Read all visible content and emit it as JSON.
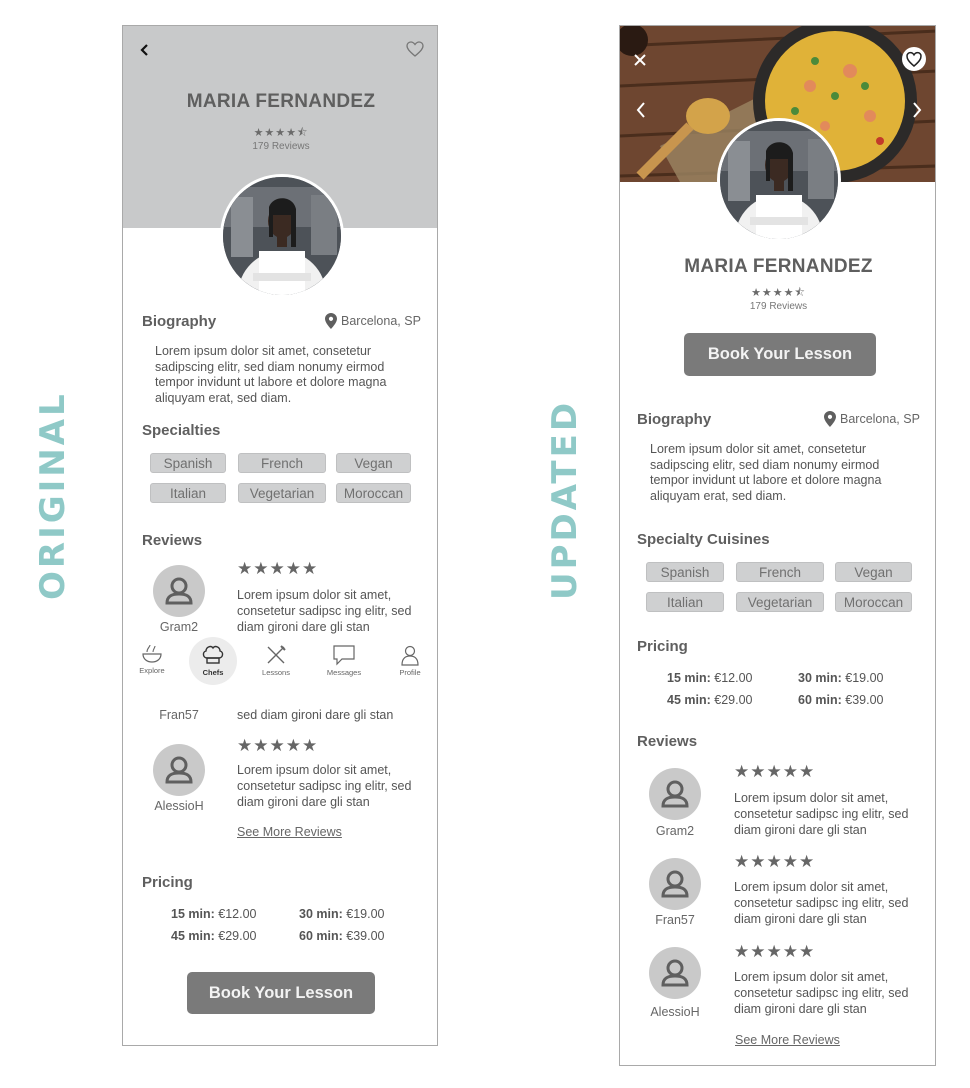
{
  "labels": {
    "original": "ORIGINAL",
    "updated": "UPDATED"
  },
  "chef": {
    "name": "MARIA FERNANDEZ",
    "stars": "★★★★⯪",
    "reviews_count": "179 Reviews",
    "location": "Barcelona, SP"
  },
  "biography": {
    "title": "Biography",
    "text": "Lorem ipsum dolor sit amet, consetetur sadipscing elitr, sed diam nonumy eirmod tempor invidunt ut labore et dolore magna aliquyam erat, sed diam."
  },
  "specialties": {
    "title_original": "Specialties",
    "title_updated": "Specialty Cuisines",
    "items": [
      "Spanish",
      "French",
      "Vegan",
      "Italian",
      "Vegetarian",
      "Moroccan"
    ]
  },
  "reviews": {
    "title": "Reviews",
    "stars": "★★★★★",
    "items": [
      {
        "user": "Gram2",
        "text": "Lorem ipsum dolor sit amet, consetetur sadipsc ing elitr, sed diam gironi dare gli stan"
      },
      {
        "user": "Fran57",
        "text": "Lorem ipsum dolor sit amet, consetetur sadipsc ing elitr, sed diam gironi dare gli stan"
      },
      {
        "user": "AlessioH",
        "text": "Lorem ipsum dolor sit amet, consetetur sadipsc ing elitr, sed diam gironi dare gli stan"
      }
    ],
    "partial_text": "sed diam gironi dare gli stan",
    "original_cut_text": "Lorem ipsum dolor sit amet, consetetur sadipsc ing elitr, sed diam gironi dare gli stan",
    "original_cut_user": "Gram2",
    "see_more": "See More Reviews"
  },
  "pricing": {
    "title": "Pricing",
    "items": [
      {
        "label": "15 min:",
        "price": "€12.00"
      },
      {
        "label": "30 min:",
        "price": "€19.00"
      },
      {
        "label": "45 min:",
        "price": "€29.00"
      },
      {
        "label": "60 min:",
        "price": "€39.00"
      }
    ]
  },
  "book_button": "Book Your Lesson",
  "nav": {
    "items": [
      "Explore",
      "Chefs",
      "Lessons",
      "Messages",
      "Profile"
    ],
    "active": "Chefs"
  },
  "colors": {
    "accent_label": "#8fc9c7",
    "header_gray": "#c8c9ca",
    "button": "#7a7a7a",
    "chip": "#cfd0d1"
  },
  "icons": {
    "back": "chevron-left-icon",
    "favorite": "heart-icon",
    "close": "close-icon",
    "location": "map-pin-icon"
  }
}
